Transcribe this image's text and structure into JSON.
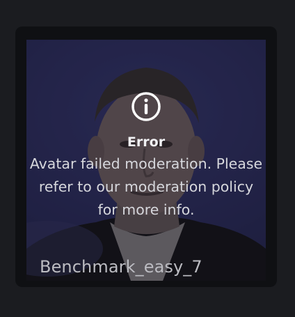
{
  "avatar_card": {
    "name": "Benchmark_easy_7",
    "error": {
      "icon": "info-icon",
      "title": "Error",
      "message": "Avatar failed moderation. Please refer to our moderation policy for more info."
    },
    "colors": {
      "page_background": "#1b1c20",
      "card_background": "#0f1013",
      "thumbnail_background": "#2f3066",
      "text": "#ffffff"
    }
  }
}
